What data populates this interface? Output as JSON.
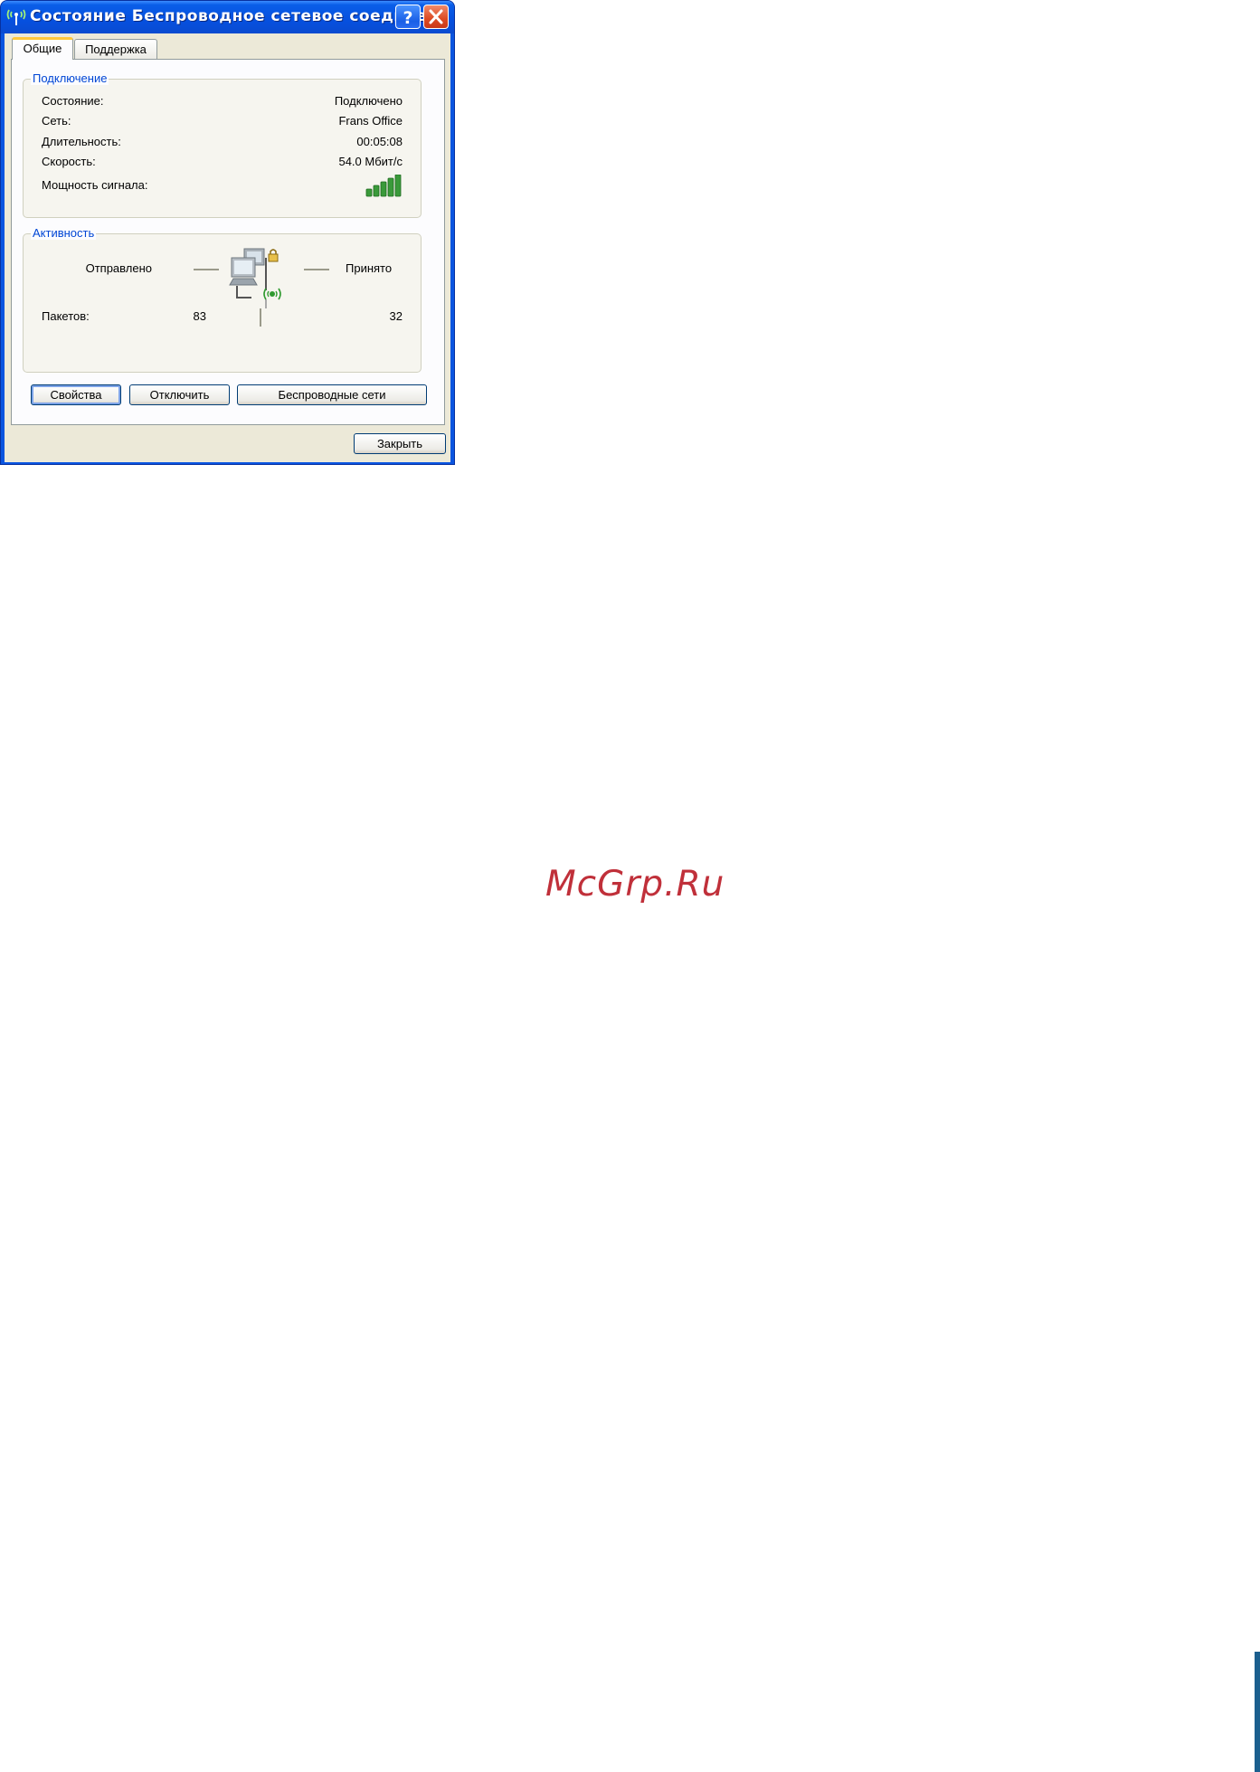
{
  "window": {
    "title": "Состояние Беспроводное сетевое соедине...",
    "help_glyph": "?",
    "colors": {
      "titlebar": "#0a5ee8",
      "client": "#ece9d8",
      "legend": "#0046d5",
      "signal": "#3a9a3a"
    }
  },
  "tabs": [
    {
      "label": "Общие",
      "active": true
    },
    {
      "label": "Поддержка",
      "active": false
    }
  ],
  "connection": {
    "legend": "Подключение",
    "rows": [
      {
        "label": "Состояние:",
        "value": "Подключено"
      },
      {
        "label": "Сеть:",
        "value": "Frans Office"
      },
      {
        "label": "Длительность:",
        "value": "00:05:08"
      },
      {
        "label": "Скорость:",
        "value": "54.0 Мбит/с"
      }
    ],
    "signal_label": "Мощность сигнала:",
    "signal_bars": 5,
    "signal_icon": "signal-strength-icon"
  },
  "activity": {
    "legend": "Активность",
    "sent_label": "Отправлено",
    "received_label": "Принято",
    "packets_label": "Пакетов:",
    "packets_sent": "83",
    "packets_received": "32",
    "icon": "network-computers-icon"
  },
  "buttons": {
    "properties": "Свойства",
    "disconnect": "Отключить",
    "wireless_networks": "Беспроводные сети",
    "close": "Закрыть"
  },
  "watermark": "McGrp.Ru"
}
